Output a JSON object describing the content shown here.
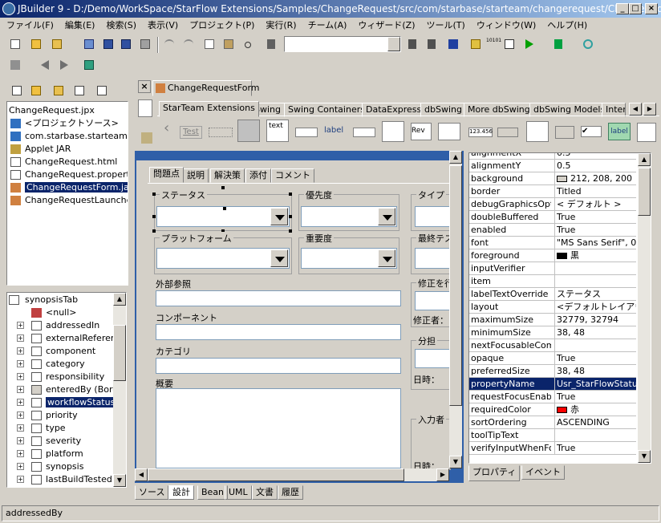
{
  "window": {
    "title": "JBuilder 9 - D:/Demo/WorkSpace/StarFlow Extensions/Samples/ChangeRequest/src/com/starbase/starteam/changerequest/ChangeRequest...",
    "minimize": "_",
    "maximize": "□",
    "close": "×"
  },
  "menu": [
    "ファイル(F)",
    "編集(E)",
    "検索(S)",
    "表示(V)",
    "プロジェクト(P)",
    "実行(R)",
    "チーム(A)",
    "ウィザード(Z)",
    "ツール(T)",
    "ウィンドウ(W)",
    "ヘルプ(H)"
  ],
  "toolbar": {
    "search_value": "",
    "binary_label": "10101"
  },
  "project": {
    "files": [
      "ChangeRequest.jpx",
      "<プロジェクトソース>",
      "com.starbase.starteam.ch",
      "Applet JAR",
      "ChangeRequest.html",
      "ChangeRequest.propertye",
      "ChangeRequestForm.java",
      "ChangeRequestLauncher."
    ],
    "selected_index": 6
  },
  "structure": {
    "items": [
      "synopsisTab",
      "<null>",
      "addressedIn",
      "externalReference",
      "component",
      "category",
      "responsibility",
      "enteredBy (BorderL",
      "workflowStatus",
      "priority",
      "type",
      "severity",
      "platform",
      "synopsis",
      "lastBuildTested"
    ],
    "selected_index": 8
  },
  "editor": {
    "file_tab": "ChangeRequestForm",
    "close": "×",
    "palette_tabs": [
      "StarTeam Extensions",
      "Swing",
      "Swing Containers",
      "DataExpress",
      "dbSwing",
      "More dbSwing",
      "dbSwing Models",
      "Inter"
    ],
    "palette_items": {
      "test": "Test",
      "text": "text",
      "label": "label",
      "rev": "Rev",
      "number": "123.456",
      "check": "✔",
      "label2": "label"
    },
    "form_tabs": [
      "問題点",
      "説明",
      "解決策",
      "添付",
      "コメント"
    ],
    "fields": {
      "status": "ステータス",
      "priority": "優先度",
      "type": "タイプ",
      "platform": "プラットフォーム",
      "severity": "重要度",
      "last_test": "最終テス",
      "ext_ref": "外部参照",
      "fix": "修正を行",
      "fixer": "修正者：",
      "component": "コンポーネント",
      "assign": "分担",
      "datetime": "日時：",
      "category": "カテゴリ",
      "summary": "概要",
      "enterer": "入力者",
      "datetime2": "日時："
    },
    "bottom_tabs": [
      "ソース",
      "設計",
      "Bean",
      "UML",
      "文書",
      "履歴"
    ],
    "active_bottom": 1
  },
  "inspector": {
    "properties": [
      {
        "key": "alignmentX",
        "value": "0.5"
      },
      {
        "key": "alignmentY",
        "value": "0.5"
      },
      {
        "key": "background",
        "value": "212, 208, 200",
        "swatch": "#d4d0c8"
      },
      {
        "key": "border",
        "value": "Titled"
      },
      {
        "key": "debugGraphicsOpti...",
        "value": "< デフォルト >"
      },
      {
        "key": "doubleBuffered",
        "value": "True"
      },
      {
        "key": "enabled",
        "value": "True"
      },
      {
        "key": "font",
        "value": "\"MS Sans Serif\", 0, 1"
      },
      {
        "key": "foreground",
        "value": "黒",
        "swatch": "#000000"
      },
      {
        "key": "inputVerifier",
        "value": ""
      },
      {
        "key": "item",
        "value": ""
      },
      {
        "key": "labelTextOverride",
        "value": "ステータス"
      },
      {
        "key": "layout",
        "value": "<デフォルトレイアウ"
      },
      {
        "key": "maximumSize",
        "value": "32779, 32794"
      },
      {
        "key": "minimumSize",
        "value": "38, 48"
      },
      {
        "key": "nextFocusableCom...",
        "value": ""
      },
      {
        "key": "opaque",
        "value": "True"
      },
      {
        "key": "preferredSize",
        "value": "38, 48"
      },
      {
        "key": "propertyName",
        "value": "Usr_StarFlowStatus"
      },
      {
        "key": "requestFocusEnabl...",
        "value": "True"
      },
      {
        "key": "requiredColor",
        "value": "赤",
        "swatch": "#ff0000"
      },
      {
        "key": "sortOrdering",
        "value": "ASCENDING"
      },
      {
        "key": "toolTipText",
        "value": ""
      },
      {
        "key": "verifyInputWhenFo...",
        "value": "True"
      }
    ],
    "selected_index": 18,
    "tabs": [
      "プロパティ",
      "イベント"
    ]
  },
  "status": {
    "text": "addressedBy"
  }
}
